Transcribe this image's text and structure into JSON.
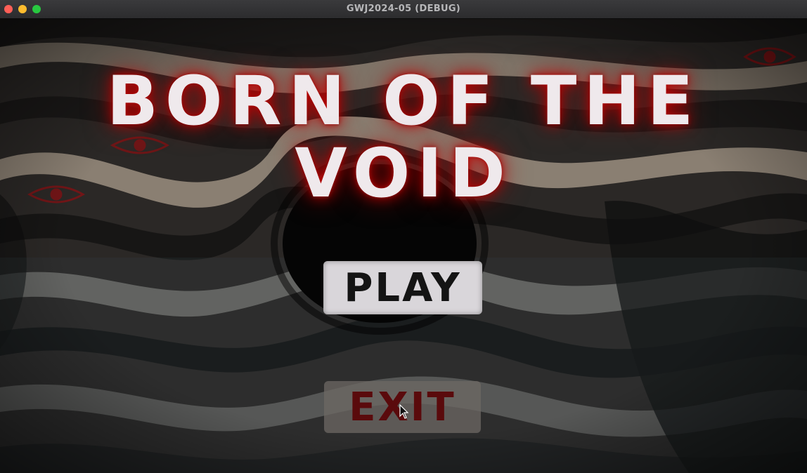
{
  "window": {
    "title": "GWJ2024-05 (DEBUG)"
  },
  "game": {
    "title_line_1": "BORN OF THE",
    "title_line_2": "VOID",
    "play_label": "PLAY",
    "exit_label": "EXIT"
  },
  "colors": {
    "title_text": "#efe9ec",
    "title_glow": "#b80000",
    "play_bg": "#d9d6da",
    "play_text": "#141414",
    "exit_bg": "#6e6864",
    "exit_text": "#5a0a0c"
  },
  "icons": {
    "close": "close-icon",
    "minimize": "minimize-icon",
    "maximize": "maximize-icon",
    "eye_symbol": "eye-icon",
    "cursor": "cursor-icon"
  }
}
